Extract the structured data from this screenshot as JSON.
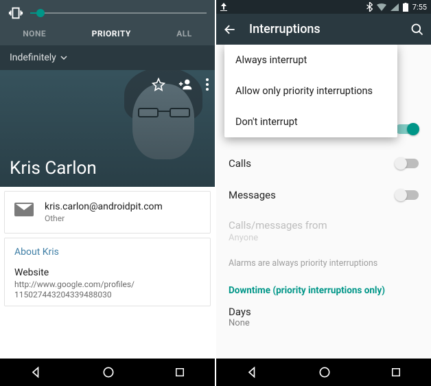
{
  "left": {
    "volume": {
      "slider_percent": 6
    },
    "tabs": {
      "none": "NONE",
      "priority": "PRIORITY",
      "all": "ALL"
    },
    "duration": {
      "label": "Indefinitely"
    },
    "contact": {
      "name": "Kris Carlon",
      "email": "kris.carlon@androidpit.com",
      "email_label": "Other",
      "about_heading": "About Kris",
      "website_label": "Website",
      "website_url_line1": "http://www.google.com/profiles/",
      "website_url_line2": "115027443204339488030"
    }
  },
  "right": {
    "status": {
      "time": "7:55"
    },
    "appbar": {
      "title": "Interruptions"
    },
    "popup": {
      "opt1": "Always interrupt",
      "opt2": "Allow only priority interruptions",
      "opt3": "Don't interrupt"
    },
    "settings": {
      "calls": "Calls",
      "messages": "Messages",
      "from_label": "Calls/messages from",
      "from_value": "Anyone",
      "alarm_note": "Alarms are always priority interruptions",
      "downtime_head": "Downtime (priority interruptions only)",
      "days_label": "Days",
      "days_value": "None"
    }
  }
}
